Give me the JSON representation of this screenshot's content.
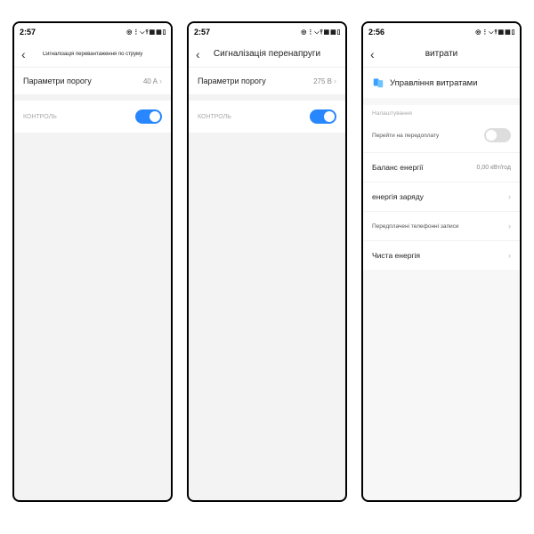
{
  "phones": [
    {
      "time": "2:57",
      "status_icons": "◎ ⋮ ⌵ ⫯ ▦ ▦ ▯",
      "title": "Сигналізація перевантаження по струму",
      "rows": {
        "threshold_label": "Параметри порогу",
        "threshold_value": "40 A",
        "control_label": "КОНТРОЛЬ",
        "control_on": true
      }
    },
    {
      "time": "2:57",
      "status_icons": "◎ ⋮ ⌵ ⫯ ▦ ▦ ▯",
      "title": "Сигналізація перенапруги",
      "rows": {
        "threshold_label": "Параметри порогу",
        "threshold_value": "275 В",
        "control_label": "КОНТРОЛЬ",
        "control_on": true
      }
    },
    {
      "time": "2:56",
      "status_icons": "◎ ⋮ ⌵ ⫯ ▦ ▦ ▯",
      "title": "витрати",
      "management_label": "Управління витратами",
      "section_label": "Налаштування",
      "items": {
        "prepaid_label": "Перейти на передоплату",
        "prepaid_on": false,
        "balance_label": "Баланс енергії",
        "balance_value": "0,00 кВт/год",
        "charge_label": "енергія заряду",
        "phone_label": "Передплачені телефонні записи",
        "clean_label": "Чиста енергія"
      }
    }
  ]
}
